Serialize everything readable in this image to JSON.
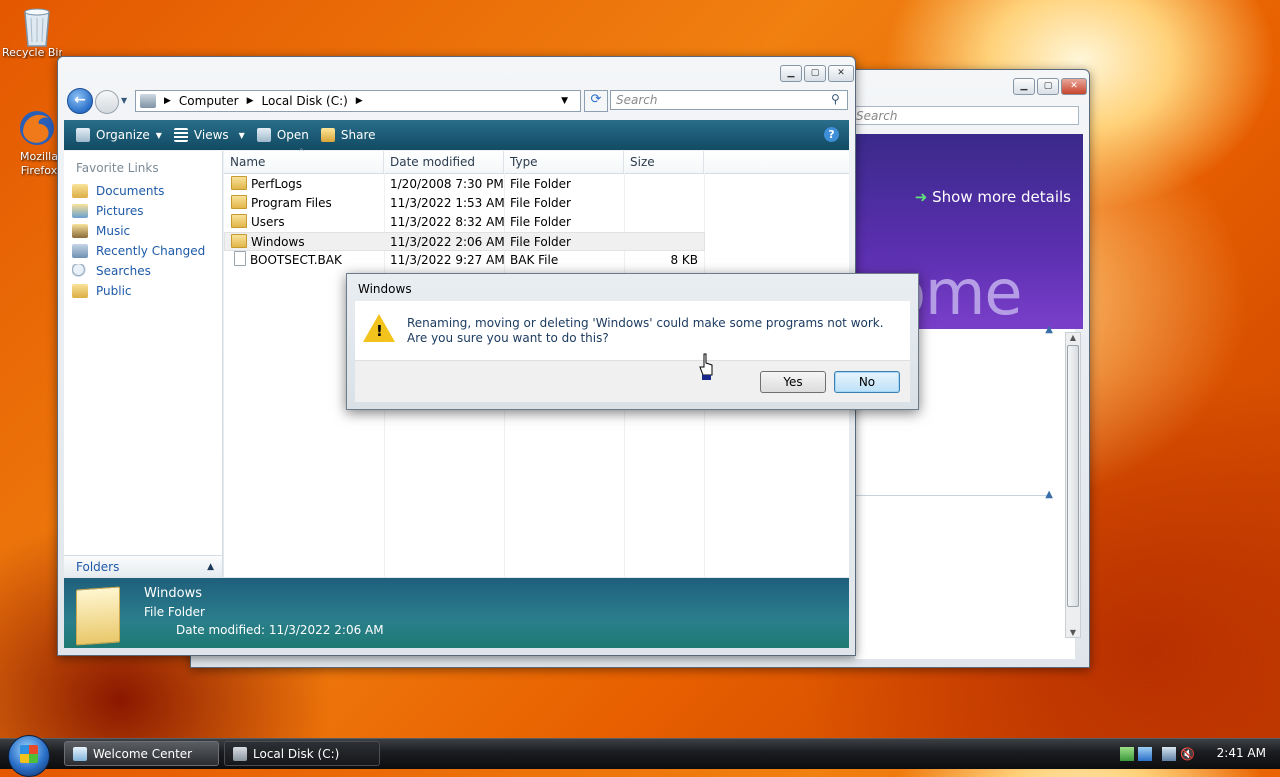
{
  "desktop": {
    "icons": [
      {
        "label": "Recycle Bin",
        "icon": "recycle-bin-icon"
      },
      {
        "label": "Mozilla Firefox",
        "icon": "firefox-icon"
      }
    ]
  },
  "welcome_window": {
    "title": "Welcome Center",
    "search_placeholder": "Search",
    "show_more": "Show more details",
    "banner_text": "come"
  },
  "explorer": {
    "address": [
      "Computer",
      "Local Disk (C:)"
    ],
    "search_placeholder": "Search",
    "toolbar": {
      "organize": "Organize",
      "views": "Views",
      "open": "Open",
      "share": "Share"
    },
    "favorite_links_header": "Favorite Links",
    "favorite_links": [
      {
        "label": "Documents",
        "icon": "documents-icon"
      },
      {
        "label": "Pictures",
        "icon": "pictures-icon"
      },
      {
        "label": "Music",
        "icon": "music-icon"
      },
      {
        "label": "Recently Changed",
        "icon": "recently-changed-icon"
      },
      {
        "label": "Searches",
        "icon": "searches-icon"
      },
      {
        "label": "Public",
        "icon": "public-icon"
      }
    ],
    "folders_label": "Folders",
    "columns": [
      "Name",
      "Date modified",
      "Type",
      "Size"
    ],
    "rows": [
      {
        "name": "PerfLogs",
        "date": "1/20/2008 7:30 PM",
        "type": "File Folder",
        "size": "",
        "kind": "folder"
      },
      {
        "name": "Program Files",
        "date": "11/3/2022 1:53 AM",
        "type": "File Folder",
        "size": "",
        "kind": "folder"
      },
      {
        "name": "Users",
        "date": "11/3/2022 8:32 AM",
        "type": "File Folder",
        "size": "",
        "kind": "folder"
      },
      {
        "name": "Windows",
        "date": "11/3/2022 2:06 AM",
        "type": "File Folder",
        "size": "",
        "kind": "folder"
      },
      {
        "name": "BOOTSECT.BAK",
        "date": "11/3/2022 9:27 AM",
        "type": "BAK File",
        "size": "8 KB",
        "kind": "file"
      }
    ],
    "details": {
      "name": "Windows",
      "type": "File Folder",
      "date_label": "Date modified:",
      "date_value": "11/3/2022 2:06 AM"
    }
  },
  "dialog": {
    "title": "Windows",
    "message": "Renaming, moving or deleting 'Windows' could make some programs not work. Are you sure you want to do this?",
    "yes": "Yes",
    "no": "No"
  },
  "taskbar": {
    "tasks": [
      {
        "label": "Welcome Center"
      },
      {
        "label": "Local Disk (C:)"
      }
    ],
    "clock": "2:41 AM"
  }
}
